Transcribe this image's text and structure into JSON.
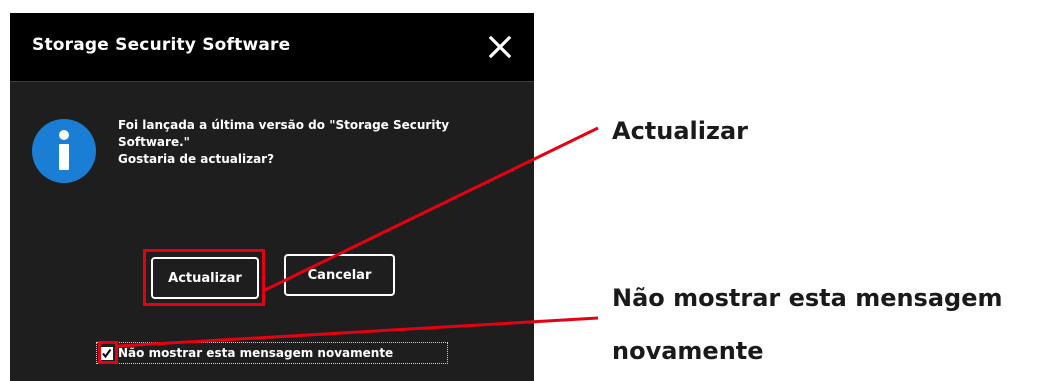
{
  "dialog": {
    "title": "Storage Security Software",
    "close_icon": "close-icon",
    "info_icon": "info-icon",
    "message_lines": [
      "Foi lançada a última versão do \"Storage Security",
      "Software.\"",
      "Gostaria de actualizar?"
    ],
    "buttons": {
      "update_label": "Actualizar",
      "cancel_label": "Cancelar"
    },
    "checkbox": {
      "label": "Não mostrar esta mensagem novamente",
      "checked": true
    },
    "colors": {
      "background": "#1e1e1e",
      "titlebar": "#000000",
      "info_icon": "#1a7fd4",
      "text": "#ffffff"
    }
  },
  "annotations": {
    "highlight_color": "#e60012",
    "callout_update": "Actualizar",
    "callout_dont_show_lines": [
      "Não mostrar esta mensagem",
      "novamente"
    ]
  }
}
